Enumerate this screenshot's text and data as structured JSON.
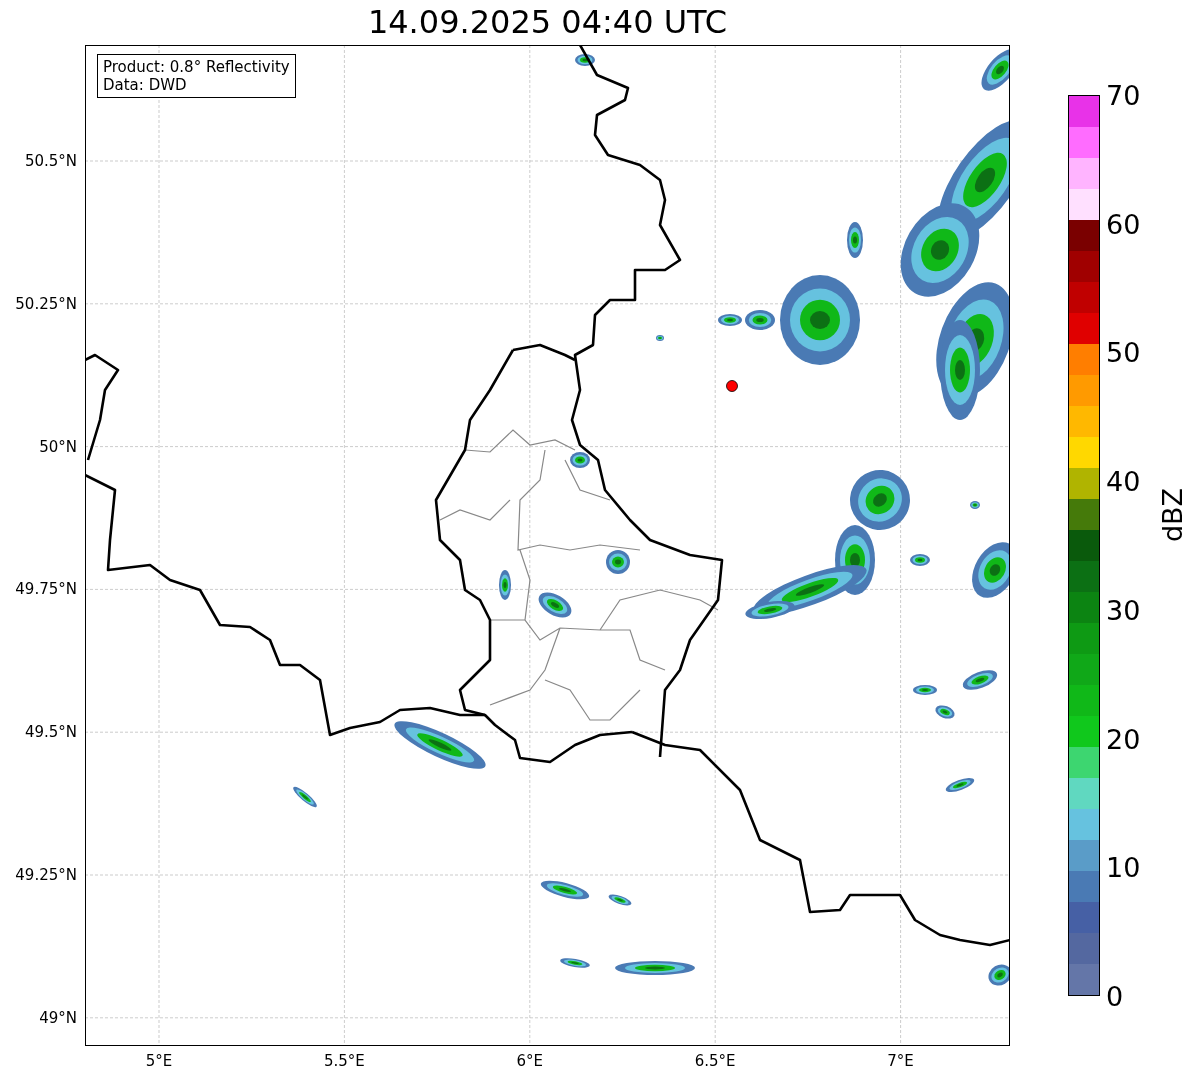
{
  "title": "14.09.2025 04:40 UTC",
  "info_box": {
    "lines": [
      "Product: 0.8° Reflectivity",
      "Data: DWD"
    ]
  },
  "map": {
    "lat_labels": [
      "50.5°N",
      "50.25°N",
      "50°N",
      "49.75°N",
      "49.5°N",
      "49.25°N",
      "49°N"
    ],
    "lon_labels": [
      "5°E",
      "5.5°E",
      "6°E",
      "6.5°E",
      "7°E"
    ]
  },
  "colorbar": {
    "label": "dBZ",
    "tick_labels": [
      "70",
      "60",
      "50",
      "40",
      "30",
      "20",
      "10",
      "0"
    ],
    "segments": [
      {
        "color": "#e832e8"
      },
      {
        "color": "#ff6cff"
      },
      {
        "color": "#ffb4ff"
      },
      {
        "color": "#ffe0ff"
      },
      {
        "color": "#7a0000"
      },
      {
        "color": "#a00000"
      },
      {
        "color": "#c00000"
      },
      {
        "color": "#e00000"
      },
      {
        "color": "#ff7e00"
      },
      {
        "color": "#ff9a00"
      },
      {
        "color": "#ffb800"
      },
      {
        "color": "#ffd800"
      },
      {
        "color": "#b0b400"
      },
      {
        "color": "#457a0a"
      },
      {
        "color": "#0a5a0c"
      },
      {
        "color": "#0c7014"
      },
      {
        "color": "#0c8412"
      },
      {
        "color": "#0e9a14"
      },
      {
        "color": "#10a818"
      },
      {
        "color": "#10b818"
      },
      {
        "color": "#10c81c"
      },
      {
        "color": "#3dd670"
      },
      {
        "color": "#60d8c0"
      },
      {
        "color": "#66c2df"
      },
      {
        "color": "#5a9cc8"
      },
      {
        "color": "#4a7ab4"
      },
      {
        "color": "#4660a5"
      },
      {
        "color": "#5468a0"
      },
      {
        "color": "#6476a8"
      }
    ]
  }
}
